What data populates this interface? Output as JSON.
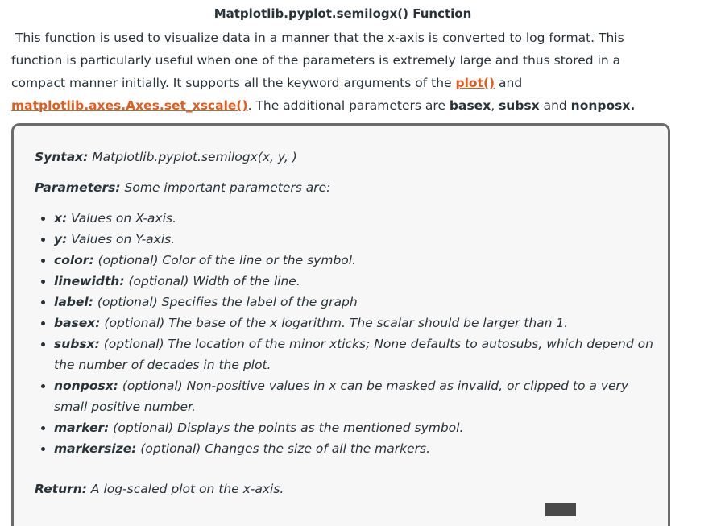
{
  "title": "Matplotlib.pyplot.semilogx() Function",
  "intro": {
    "text1": "This function is used to visualize data in a manner that the x-axis is converted to log format. This function is particularly useful when one of the parameters is extremely large and thus stored in a compact manner initially. It supports all the keyword arguments of the ",
    "link1": "plot()",
    "text2": " and ",
    "link2": "matplotlib.axes.Axes.set_xscale()",
    "text3": ". The additional parameters are ",
    "b1": "basex",
    "sep1": ", ",
    "b2": "subsx",
    "sep2": " and ",
    "b3": "nonposx."
  },
  "syntax": {
    "label": "Syntax:",
    "value": " Matplotlib.pyplot.semilogx(x, y, )"
  },
  "parameters": {
    "label": "Parameters:",
    "value": " Some important parameters are:"
  },
  "param_list": [
    {
      "name": "x:",
      "desc": " Values on X-axis."
    },
    {
      "name": "y:",
      "desc": " Values on Y-axis."
    },
    {
      "name": "color:",
      "desc": " (optional) Color of the line or the symbol."
    },
    {
      "name": "linewidth:",
      "desc": " (optional) Width of the line."
    },
    {
      "name": "label:",
      "desc": " (optional) Specifies the label of the graph"
    },
    {
      "name": "basex:",
      "desc": " (optional) The base of the x logarithm. The scalar should be larger than 1."
    },
    {
      "name": "subsx:",
      "desc": " (optional) The location of the minor xticks; None defaults to autosubs, which depend on the number of decades in the plot."
    },
    {
      "name": "nonposx:",
      "desc": " (optional) Non-positive values in x can be masked as invalid, or clipped to a very small positive number."
    },
    {
      "name": "marker:",
      "desc": " (optional) Displays the points as the mentioned symbol."
    },
    {
      "name": "markersize:",
      "desc": " (optional) Changes the size of all the markers."
    }
  ],
  "return": {
    "label": "Return:",
    "value": " A log-scaled plot on the x-axis."
  }
}
